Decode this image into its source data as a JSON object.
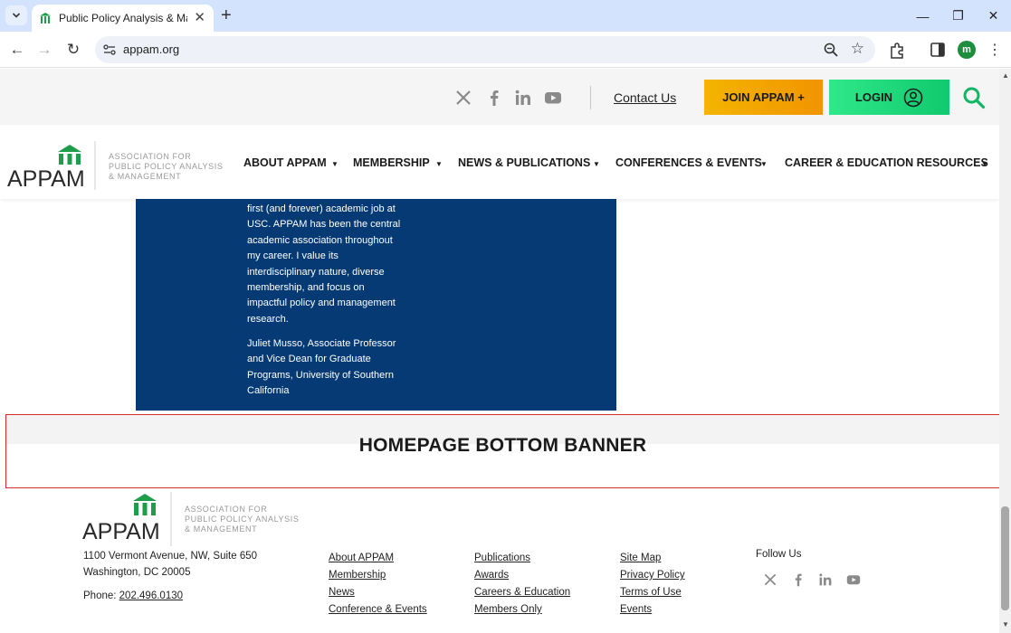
{
  "browser": {
    "tab_title": "Public Policy Analysis & Management",
    "url": "appam.org",
    "profile_initial": "m"
  },
  "utility": {
    "contact_label": "Contact Us",
    "join_label": "JOIN APPAM +",
    "login_label": "LOGIN"
  },
  "logo": {
    "acronym": "APPAM",
    "line1": "ASSOCIATION FOR",
    "line2": "PUBLIC POLICY ANALYSIS",
    "line3": "& MANAGEMENT"
  },
  "nav": {
    "items": [
      {
        "label": "ABOUT APPAM"
      },
      {
        "label": "MEMBERSHIP"
      },
      {
        "label": "NEWS & PUBLICATIONS"
      },
      {
        "label": "CONFERENCES & EVENTS"
      },
      {
        "label": "CAREER & EDUCATION RESOURCES"
      }
    ]
  },
  "testimonial": {
    "quote": "first (and forever) academic job at USC. APPAM has been the central academic association throughout my career. I value its interdisciplinary nature, diverse membership, and focus on impactful policy and management research.",
    "author": "Juliet Musso, Associate Professor and Vice Dean for Graduate Programs, University of Southern California"
  },
  "banner": {
    "title": "HOMEPAGE BOTTOM BANNER"
  },
  "footer": {
    "address_line1": "1100 Vermont Avenue, NW, Suite 650",
    "address_line2": "Washington, DC 20005",
    "phone_label": "Phone: ",
    "phone_number": "202.496.0130",
    "col1": [
      "About APPAM",
      "Membership",
      "News",
      "Conference & Events"
    ],
    "col2": [
      "Publications",
      "Awards",
      "Careers & Education",
      "Members Only"
    ],
    "col3": [
      "Site Map",
      "Privacy Policy",
      "Terms of Use",
      "Events"
    ],
    "follow_label": "Follow Us"
  },
  "icons": {
    "social": [
      "x-icon",
      "facebook-icon",
      "linkedin-icon",
      "youtube-icon"
    ]
  },
  "colors": {
    "testimonial_bg": "#053a75",
    "join_button": "#f4b400",
    "login_button": "#2ee889",
    "brand_green": "#1e9e4a",
    "banner_border": "#d62c2c"
  }
}
